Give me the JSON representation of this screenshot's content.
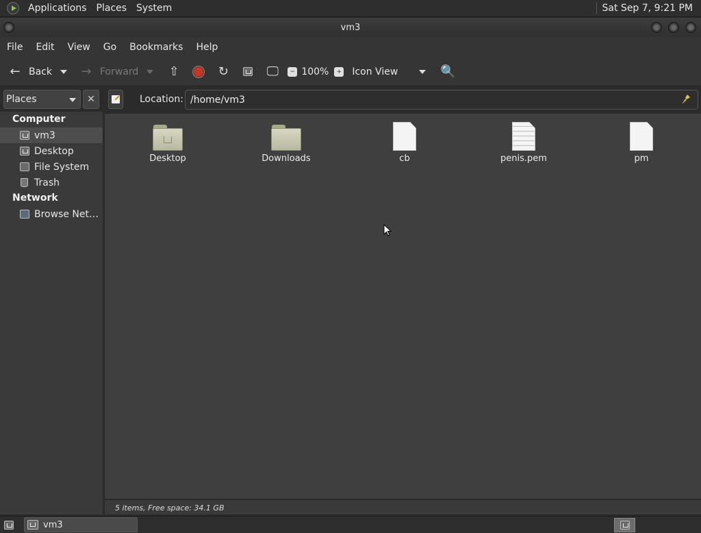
{
  "top_panel": {
    "menus": [
      "Applications",
      "Places",
      "System"
    ],
    "clock": "Sat Sep  7,  9:21 PM"
  },
  "window": {
    "title": "vm3"
  },
  "menubar": {
    "items": [
      "File",
      "Edit",
      "View",
      "Go",
      "Bookmarks",
      "Help"
    ]
  },
  "toolbar": {
    "back_label": "Back",
    "forward_label": "Forward",
    "zoom_value": "100%",
    "view_mode": "Icon View"
  },
  "sidebar": {
    "header": "Places",
    "groups": [
      {
        "label": "Computer",
        "items": [
          {
            "label": "vm3",
            "icon": "home-folder-icon",
            "selected": true
          },
          {
            "label": "Desktop",
            "icon": "desktop-icon",
            "selected": false
          },
          {
            "label": "File System",
            "icon": "drive-icon",
            "selected": false
          },
          {
            "label": "Trash",
            "icon": "trash-icon",
            "selected": false
          }
        ]
      },
      {
        "label": "Network",
        "items": [
          {
            "label": "Browse Net…",
            "icon": "network-icon",
            "selected": false
          }
        ]
      }
    ]
  },
  "location": {
    "label": "Location:",
    "value": "/home/vm3"
  },
  "files": [
    {
      "name": "Desktop",
      "kind": "folder-desktop"
    },
    {
      "name": "Downloads",
      "kind": "folder"
    },
    {
      "name": "cb",
      "kind": "file"
    },
    {
      "name": "penis.pem",
      "kind": "text-file"
    },
    {
      "name": "pm",
      "kind": "file"
    }
  ],
  "status": {
    "text": "5 items, Free space: 34.1 GB"
  },
  "taskbar": {
    "task_label": "vm3"
  },
  "colors": {
    "panel": "#2e2e2e",
    "window_bg": "#3f3f3f",
    "sidebar_bg": "#3a3a3a",
    "stop_red": "#c0392b"
  }
}
